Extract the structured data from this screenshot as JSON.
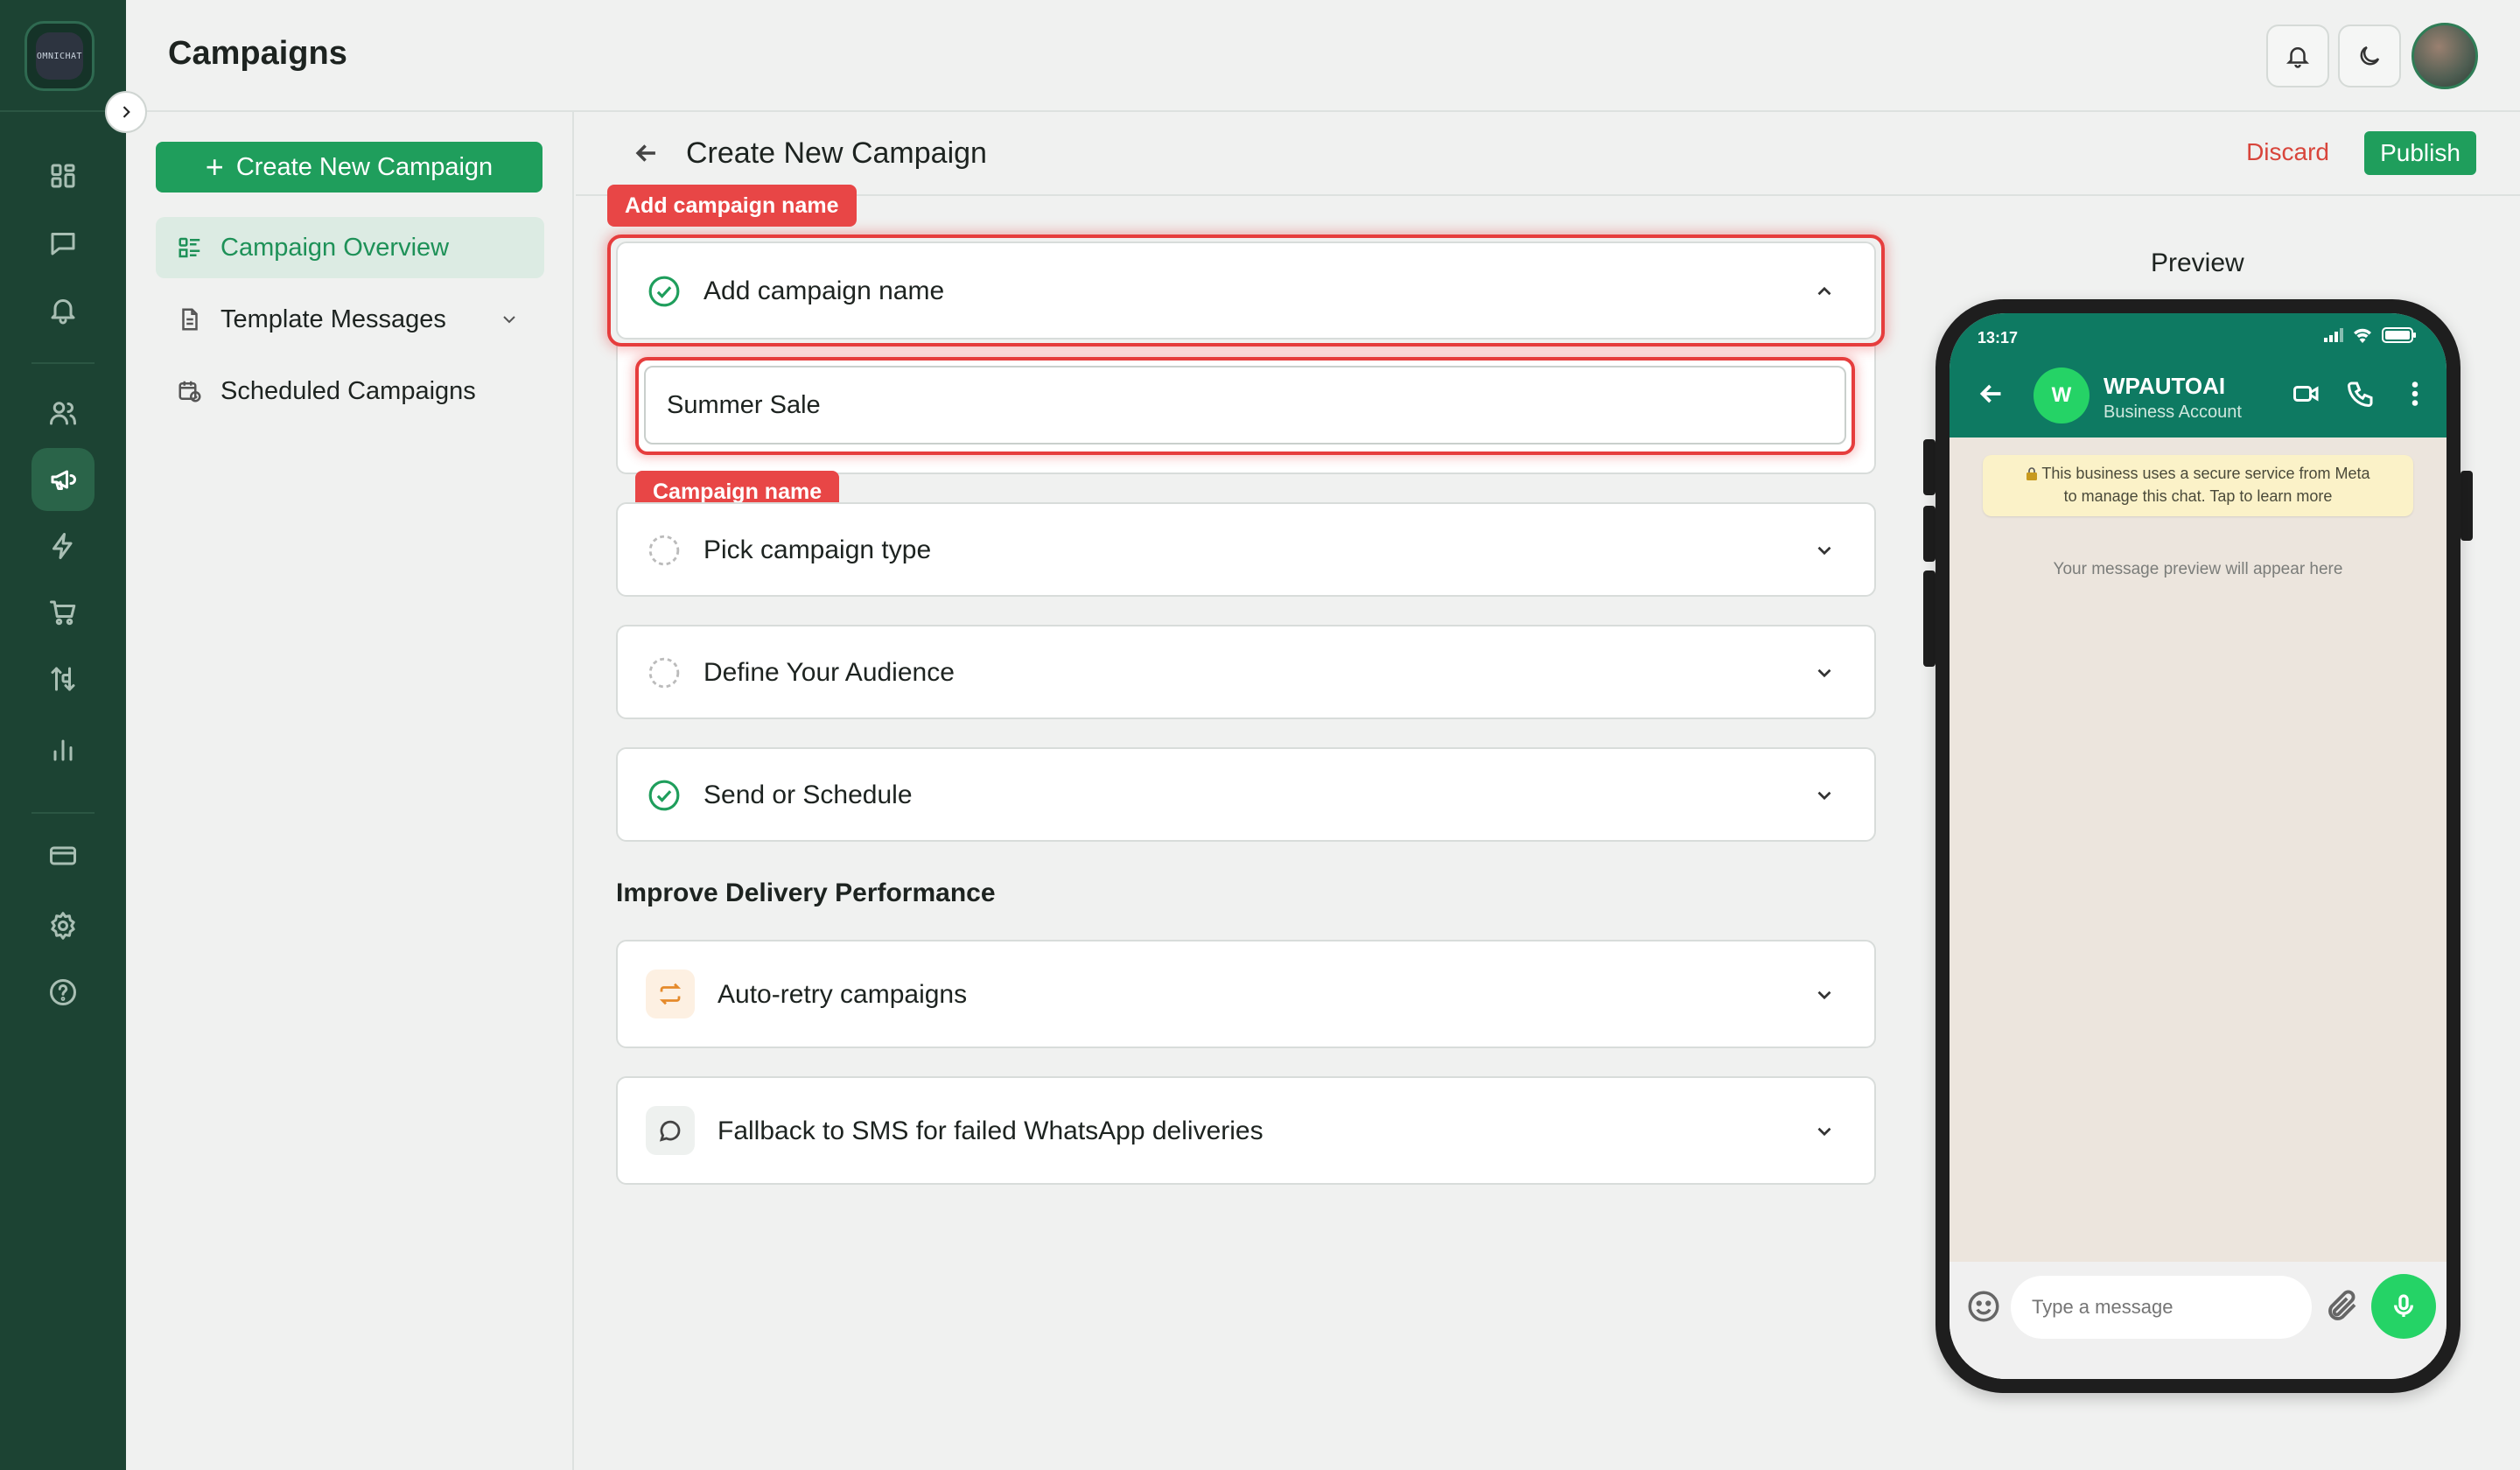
{
  "app": {
    "logo_text": "OMNICHAT",
    "page_title": "Campaigns"
  },
  "rail": {
    "icons": [
      "dashboard-icon",
      "chat-icon",
      "bell-icon",
      "users-icon",
      "megaphone-icon",
      "lightning-icon",
      "cart-icon",
      "flow-icon",
      "bar-chart-icon",
      "card-icon",
      "settings-icon",
      "help-icon"
    ],
    "active": "megaphone-icon"
  },
  "topbar": {
    "icons": [
      "bell-icon",
      "moon-icon",
      "avatar"
    ]
  },
  "sidebar": {
    "create_label": "Create New Campaign",
    "items": [
      {
        "label": "Campaign Overview",
        "icon": "overview-icon",
        "active": true
      },
      {
        "label": "Template Messages",
        "icon": "document-icon",
        "expandable": true
      },
      {
        "label": "Scheduled Campaigns",
        "icon": "calendar-clock-icon"
      }
    ]
  },
  "content": {
    "title": "Create New Campaign",
    "discard_label": "Discard",
    "publish_label": "Publish",
    "steps": [
      {
        "label": "Add campaign name",
        "status": "complete",
        "expanded": true
      },
      {
        "label": "Pick campaign type",
        "status": "pending"
      },
      {
        "label": "Define Your Audience",
        "status": "pending"
      },
      {
        "label": "Send or Schedule",
        "status": "complete"
      }
    ],
    "campaign_name_value": "Summer Sale",
    "section_title": "Improve Delivery Performance",
    "features": [
      {
        "label": "Auto-retry campaigns",
        "icon": "retry-icon"
      },
      {
        "label": "Fallback to SMS for failed WhatsApp deliveries",
        "icon": "message-bubble-icon"
      }
    ],
    "annotations": {
      "card_tag": "Add campaign name",
      "input_tag": "Campaign name"
    }
  },
  "preview": {
    "label": "Preview",
    "time": "13:17",
    "avatar_letter": "W",
    "business_name": "WPAUTOAI",
    "business_sub": "Business Account",
    "notice_line1": "This business uses a secure service from Meta",
    "notice_line2": "to manage this chat. Tap to learn more",
    "placeholder_text": "Your message preview will appear here",
    "input_placeholder": "Type a message"
  },
  "colors": {
    "rail_bg": "#1c4333",
    "brand_green": "#1f9e5c",
    "discard_red": "#d8453b",
    "annotation_red": "#e84646",
    "wa_header": "#0e7a62"
  }
}
